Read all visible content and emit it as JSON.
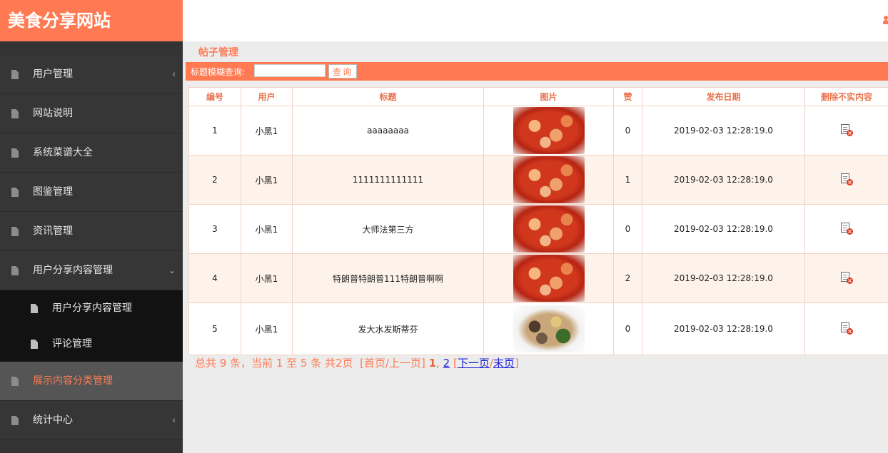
{
  "brand": "美食分享网站",
  "sidebar": {
    "items": [
      {
        "label": "用户管理",
        "caret": "‹"
      },
      {
        "label": "网站说明",
        "caret": ""
      },
      {
        "label": "系统菜谱大全",
        "caret": ""
      },
      {
        "label": "图鉴管理",
        "caret": ""
      },
      {
        "label": "资讯管理",
        "caret": ""
      },
      {
        "label": "用户分享内容管理",
        "caret": "⌄"
      }
    ],
    "sub_items": [
      {
        "label": "用户分享内容管理"
      },
      {
        "label": "评论管理"
      }
    ],
    "bottom_items": [
      {
        "label": "展示内容分类管理",
        "caret": "",
        "active": true
      },
      {
        "label": "统计中心",
        "caret": "‹"
      }
    ]
  },
  "main": {
    "page_title": "帖子管理",
    "search": {
      "label": "标题模糊查询:",
      "value": "",
      "placeholder": "",
      "button": "查询"
    },
    "table": {
      "headers": [
        "编号",
        "用户",
        "标题",
        "图片",
        "赞",
        "发布日期",
        "删除不实内容"
      ],
      "rows": [
        {
          "id": "1",
          "user": "小黑1",
          "title": "aaaaaaaa",
          "image": "shrimp",
          "likes": "0",
          "date": "2019-02-03 12:28:19.0"
        },
        {
          "id": "2",
          "user": "小黑1",
          "title": "1111111111111",
          "image": "shrimp",
          "likes": "1",
          "date": "2019-02-03 12:28:19.0"
        },
        {
          "id": "3",
          "user": "小黑1",
          "title": "大师法第三方",
          "image": "shrimp",
          "likes": "0",
          "date": "2019-02-03 12:28:19.0"
        },
        {
          "id": "4",
          "user": "小黑1",
          "title": "特朗普特朗普111特朗普啊啊",
          "image": "shrimp",
          "likes": "2",
          "date": "2019-02-03 12:28:19.0"
        },
        {
          "id": "5",
          "user": "小黑1",
          "title": "发大水发斯蒂芬",
          "image": "vegetables",
          "likes": "0",
          "date": "2019-02-03 12:28:19.0"
        }
      ]
    },
    "pager": {
      "summary": "总共 9 条，当前 1 至 5 条 共2页",
      "first_prev": "[首页/上一页]",
      "current": "1",
      "comma": ",",
      "page2": "2",
      "open_bracket": "[",
      "next": "下一页",
      "slash": "/",
      "last": "末页",
      "close_bracket": "]"
    }
  },
  "colors": {
    "accent": "#ff7a52",
    "sidebar": "#333333",
    "row_alt": "#fdf3ea"
  },
  "icons": {
    "user": "user-icon",
    "delete": "delete-record-icon",
    "nav": "document-icon"
  }
}
